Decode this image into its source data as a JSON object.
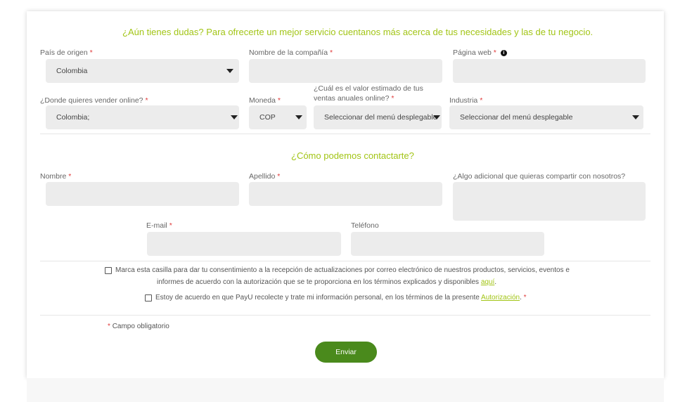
{
  "section1": {
    "heading": "¿Aún tienes dudas? Para ofrecerte un mejor servicio cuentanos más acerca de tus necesidades y las de tu negocio.",
    "pais_label": "País de origen",
    "pais_value": "Colombia",
    "compania_label": "Nombre de la compañía",
    "web_label": "Página web",
    "vender_label": "¿Donde quieres vender online?",
    "vender_value": "Colombia;",
    "moneda_label": "Moneda",
    "moneda_value": "COP",
    "ventas_label_line1": "¿Cuál es el valor estimado de tus",
    "ventas_label_line2": "ventas anuales online?",
    "ventas_value": "Seleccionar del menú desplegable",
    "industria_label": "Industria",
    "industria_value": "Seleccionar del menú desplegable"
  },
  "section2": {
    "heading": "¿Cómo podemos contactarte?",
    "nombre_label": "Nombre",
    "apellido_label": "Apellido",
    "adicional_label": "¿Algo adicional que quieras compartir con nosotros?",
    "email_label": "E-mail",
    "telefono_label": "Teléfono"
  },
  "consent": {
    "line1": "Marca esta casilla para dar tu consentimiento a la recepción de actualizaciones por correo electrónico de nuestros productos, servicios, eventos e",
    "line2": "informes de acuerdo con la autorización que se te proporciona en los términos explicados y disponibles",
    "aqui": "aquí",
    "acuerdo": "Estoy de acuerdo en que PayU recolecte y trate mi información personal, en los términos de la presente",
    "autorizacion": "Autorización"
  },
  "required_marker": "*",
  "info_glyph": "i",
  "campo_obligatorio": "Campo obligatorio",
  "submit_label": "Enviar",
  "colors": {
    "accent": "#a2c516",
    "button": "#4a8a1c",
    "required": "#e03b3b",
    "field": "#ececec"
  }
}
